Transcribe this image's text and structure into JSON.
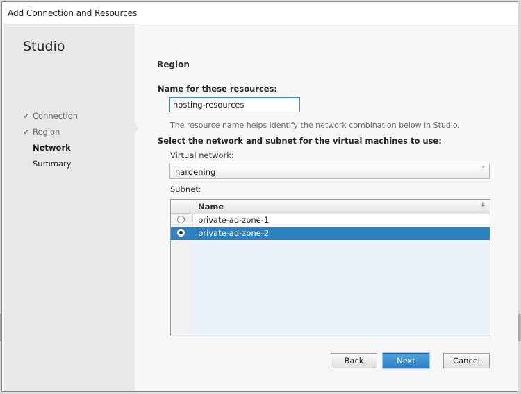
{
  "window": {
    "title": "Add Connection and Resources"
  },
  "sidebar": {
    "brand": "Studio",
    "steps": [
      {
        "label": "Connection",
        "state": "done"
      },
      {
        "label": "Region",
        "state": "done"
      },
      {
        "label": "Network",
        "state": "current"
      },
      {
        "label": "Summary",
        "state": "pending"
      }
    ],
    "check_icon": "check-icon"
  },
  "main": {
    "section_title": "Region",
    "name_label": "Name for these resources:",
    "name_value": "hosting-resources",
    "name_help": "The resource name helps identify the network combination below in Studio.",
    "select_heading": "Select the network and subnet for the virtual machines to use:",
    "vnet_label": "Virtual network:",
    "vnet_value": "hardening",
    "subnet_label": "Subnet:",
    "subnet_table": {
      "columns": [
        "Name"
      ],
      "rows": [
        {
          "name": "private-ad-zone-1",
          "selected": false
        },
        {
          "name": "private-ad-zone-2",
          "selected": true
        }
      ]
    }
  },
  "footer": {
    "back": "Back",
    "next": "Next",
    "cancel": "Cancel"
  },
  "colors": {
    "accent": "#2d83c2",
    "sidebar_bg": "#e8e8e8"
  }
}
